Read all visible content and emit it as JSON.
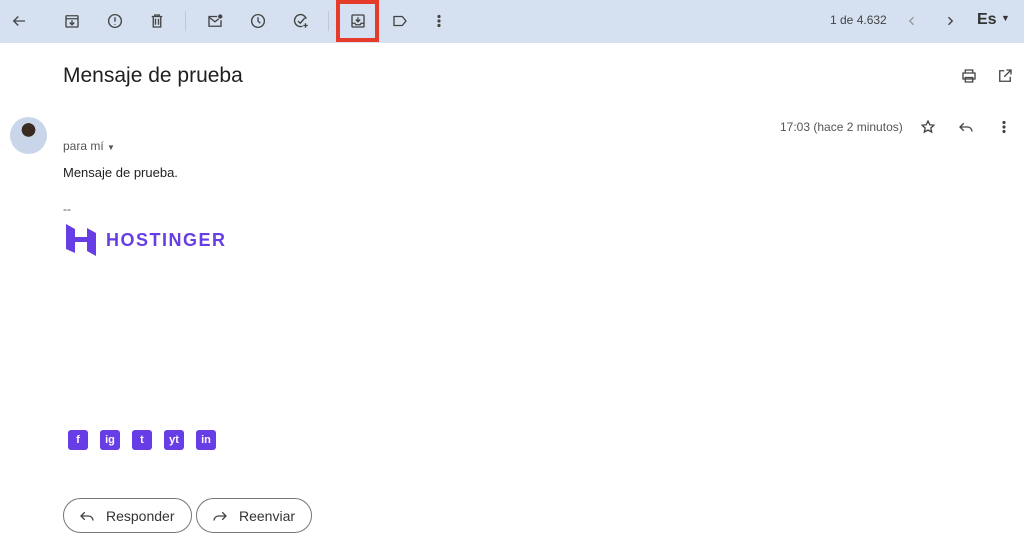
{
  "toolbar": {
    "pagination": "1 de 4.632",
    "language": "Es"
  },
  "message": {
    "subject": "Mensaje de prueba",
    "recipient": "para mí",
    "timestamp": "17:03 (hace 2 minutos)",
    "body": "Mensaje de prueba.",
    "signature_separator": "--",
    "logo_text": "HOSTINGER",
    "social": [
      "f",
      "ig",
      "t",
      "yt",
      "in"
    ]
  },
  "actions": {
    "reply": "Responder",
    "forward": "Reenviar"
  },
  "colors": {
    "brand": "#673de6",
    "toolbar": "#d5e0f0",
    "highlight": "#e53b2a"
  }
}
